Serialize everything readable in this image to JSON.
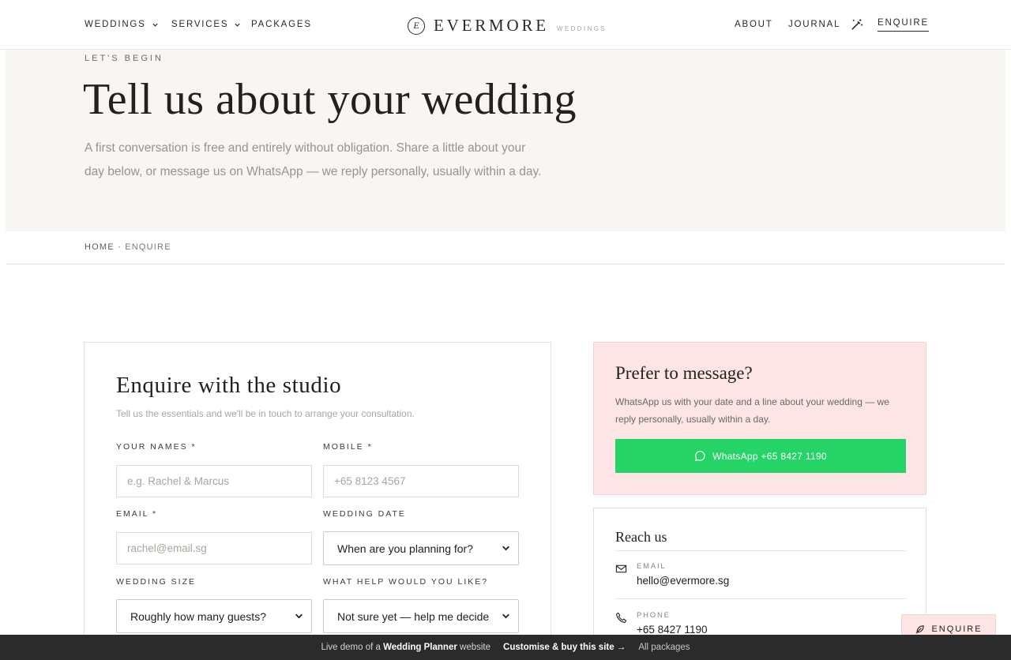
{
  "nav": {
    "weddings": "WEDDINGS",
    "services": "SERVICES",
    "packages": "PACKAGES",
    "about": "ABOUT",
    "journal": "JOURNAL",
    "enquire": "ENQUIRE"
  },
  "logo": {
    "mark": "E",
    "word": "EVERMORE",
    "sub": "WEDDINGS"
  },
  "hero": {
    "eyebrow": "LET'S BEGIN",
    "title": "Tell us about your wedding",
    "description": "A first conversation is free and entirely without obligation. Share a little about your day below, or message us on WhatsApp — we reply personally, usually within a day."
  },
  "breadcrumb": {
    "home": "HOME",
    "separator": "·",
    "current": "ENQUIRE"
  },
  "form": {
    "title": "Enquire with the studio",
    "subtitle": "Tell us the essentials and we'll be in touch to arrange your consultation.",
    "names_label": "YOUR NAMES *",
    "names_placeholder": "e.g. Rachel & Marcus",
    "mobile_label": "MOBILE *",
    "mobile_placeholder": "+65 8123 4567",
    "email_label": "EMAIL *",
    "email_placeholder": "rachel@email.sg",
    "date_label": "WEDDING DATE",
    "date_value": "When are you planning for?",
    "size_label": "WEDDING SIZE",
    "size_value": "Roughly how many guests?",
    "help_label": "WHAT HELP WOULD YOU LIKE?",
    "help_value": "Not sure yet — help me decide"
  },
  "message_card": {
    "title": "Prefer to message?",
    "description": "WhatsApp us with your date and a line about your wedding — we reply personally, usually within a day.",
    "button": "WhatsApp +65 8427 1190"
  },
  "reach": {
    "title": "Reach us",
    "email_label": "EMAIL",
    "email_value": "hello@evermore.sg",
    "phone_label": "PHONE",
    "phone_value": "+65 8427 1190"
  },
  "float_button": "ENQUIRE",
  "demo_bar": {
    "prefix": "Live demo of a",
    "site_type": "Wedding Planner",
    "suffix": "website",
    "cta": "Customise & buy this site →",
    "all": "All packages"
  },
  "colors": {
    "hero_bg": "#f8f6f2",
    "message_bg": "#fde5e6",
    "whatsapp_green": "#26d366",
    "demo_bar": "#2b2b2b"
  }
}
